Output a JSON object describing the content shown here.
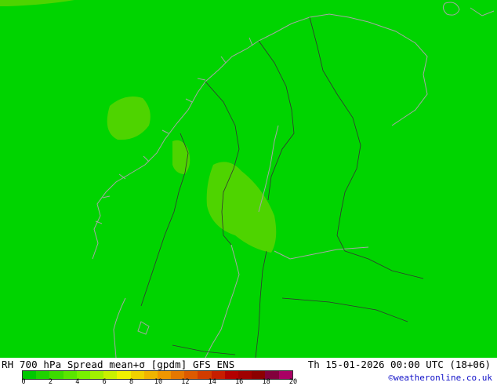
{
  "map": {
    "background_color": "#00d400",
    "higher_spread_color": "#4ed400",
    "coastline_color": "#a6a6a6",
    "border_color": "#333333"
  },
  "header": {
    "title": "RH 700 hPa Spread mean+σ [gpdm] GFS ENS",
    "datetime": "Th 15-01-2026 00:00 UTC (18+06)"
  },
  "credit": "©weatheronline.co.uk",
  "legend": {
    "colors": [
      "#00c800",
      "#1fd200",
      "#3cdc00",
      "#5ae600",
      "#78f000",
      "#a0f000",
      "#c8f000",
      "#f0f000",
      "#f0d200",
      "#f0b400",
      "#f09600",
      "#e67800",
      "#dc5a00",
      "#d23c00",
      "#c81e00",
      "#b40000",
      "#a00000",
      "#8c0000",
      "#82003c",
      "#aa0064"
    ],
    "ticks": [
      "0",
      "2",
      "4",
      "6",
      "8",
      "10",
      "12",
      "14",
      "16",
      "18",
      "20"
    ]
  }
}
